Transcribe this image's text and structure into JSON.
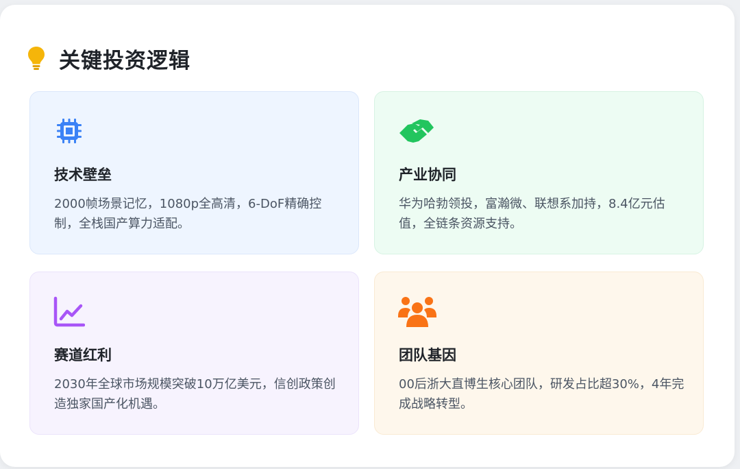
{
  "header": {
    "title": "关键投资逻辑",
    "icon": "lightbulb-icon",
    "icon_color": "#f5b50a"
  },
  "cards": [
    {
      "title": "技术壁垒",
      "description": "2000帧场景记忆，1080p全高清，6-DoF精确控制，全栈国产算力适配。",
      "icon": "cpu-chip-icon",
      "accent": "#3b82f6"
    },
    {
      "title": "产业协同",
      "description": "华为哈勃领投，富瀚微、联想系加持，8.4亿元估值，全链条资源支持。",
      "icon": "handshake-icon",
      "accent": "#22c55e"
    },
    {
      "title": "赛道红利",
      "description": "2030年全球市场规模突破10万亿美元，信创政策创造独家国产化机遇。",
      "icon": "line-chart-icon",
      "accent": "#a855f7"
    },
    {
      "title": "团队基因",
      "description": "00后浙大直博生核心团队，研发占比超30%，4年完成战略转型。",
      "icon": "team-users-icon",
      "accent": "#f97316"
    }
  ]
}
